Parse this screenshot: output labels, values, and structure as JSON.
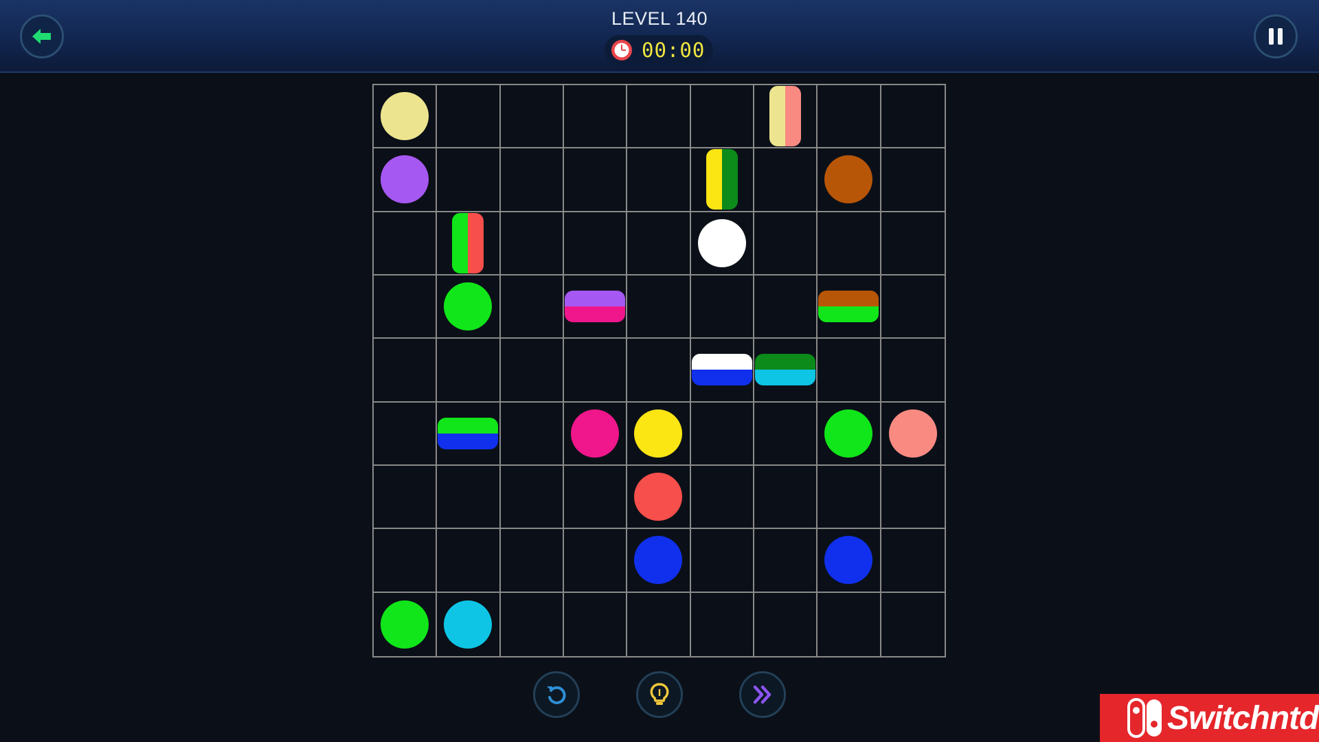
{
  "header": {
    "level_title": "LEVEL 140",
    "timer": "00:00",
    "back_icon": "arrow-left-icon",
    "pause_icon": "pause-icon",
    "timer_icon": "clock-icon"
  },
  "colors": {
    "cream": "#ede48f",
    "purple": "#a658f2",
    "brown": "#b85608",
    "white": "#ffffff",
    "green": "#10e619",
    "pink": "#f0168b",
    "yellow": "#fbe513",
    "salmon": "#f98a82",
    "red": "#f74f4b",
    "blue": "#1030ed",
    "cyan": "#0ec5e6",
    "darkgreen": "#0c8a1a"
  },
  "board": {
    "rows": 9,
    "cols": 9,
    "pieces": [
      {
        "row": 0,
        "col": 0,
        "type": "dot",
        "colors": [
          "cream"
        ]
      },
      {
        "row": 0,
        "col": 6,
        "type": "v",
        "colors": [
          "cream",
          "salmon"
        ]
      },
      {
        "row": 1,
        "col": 0,
        "type": "dot",
        "colors": [
          "purple"
        ]
      },
      {
        "row": 1,
        "col": 5,
        "type": "v",
        "colors": [
          "yellow",
          "darkgreen"
        ]
      },
      {
        "row": 1,
        "col": 7,
        "type": "dot",
        "colors": [
          "brown"
        ]
      },
      {
        "row": 2,
        "col": 1,
        "type": "v",
        "colors": [
          "green",
          "red"
        ]
      },
      {
        "row": 2,
        "col": 5,
        "type": "dot",
        "colors": [
          "white"
        ]
      },
      {
        "row": 3,
        "col": 1,
        "type": "dot",
        "colors": [
          "green"
        ]
      },
      {
        "row": 3,
        "col": 3,
        "type": "h",
        "colors": [
          "purple",
          "pink"
        ]
      },
      {
        "row": 3,
        "col": 7,
        "type": "h",
        "colors": [
          "brown",
          "green"
        ]
      },
      {
        "row": 4,
        "col": 5,
        "type": "h",
        "colors": [
          "white",
          "blue"
        ]
      },
      {
        "row": 4,
        "col": 6,
        "type": "h",
        "colors": [
          "darkgreen",
          "cyan"
        ]
      },
      {
        "row": 5,
        "col": 1,
        "type": "h",
        "colors": [
          "green",
          "blue"
        ]
      },
      {
        "row": 5,
        "col": 3,
        "type": "dot",
        "colors": [
          "pink"
        ]
      },
      {
        "row": 5,
        "col": 4,
        "type": "dot",
        "colors": [
          "yellow"
        ]
      },
      {
        "row": 5,
        "col": 7,
        "type": "dot",
        "colors": [
          "green"
        ]
      },
      {
        "row": 5,
        "col": 8,
        "type": "dot",
        "colors": [
          "salmon"
        ]
      },
      {
        "row": 6,
        "col": 4,
        "type": "dot",
        "colors": [
          "red"
        ]
      },
      {
        "row": 7,
        "col": 4,
        "type": "dot",
        "colors": [
          "blue"
        ]
      },
      {
        "row": 7,
        "col": 7,
        "type": "dot",
        "colors": [
          "blue"
        ]
      },
      {
        "row": 8,
        "col": 0,
        "type": "dot",
        "colors": [
          "green"
        ]
      },
      {
        "row": 8,
        "col": 1,
        "type": "dot",
        "colors": [
          "cyan"
        ]
      }
    ]
  },
  "controls": {
    "undo_icon": "undo-icon",
    "hint_icon": "lightbulb-icon",
    "skip_icon": "double-chevron-right-icon"
  },
  "watermark": {
    "text": "Switchntd"
  }
}
